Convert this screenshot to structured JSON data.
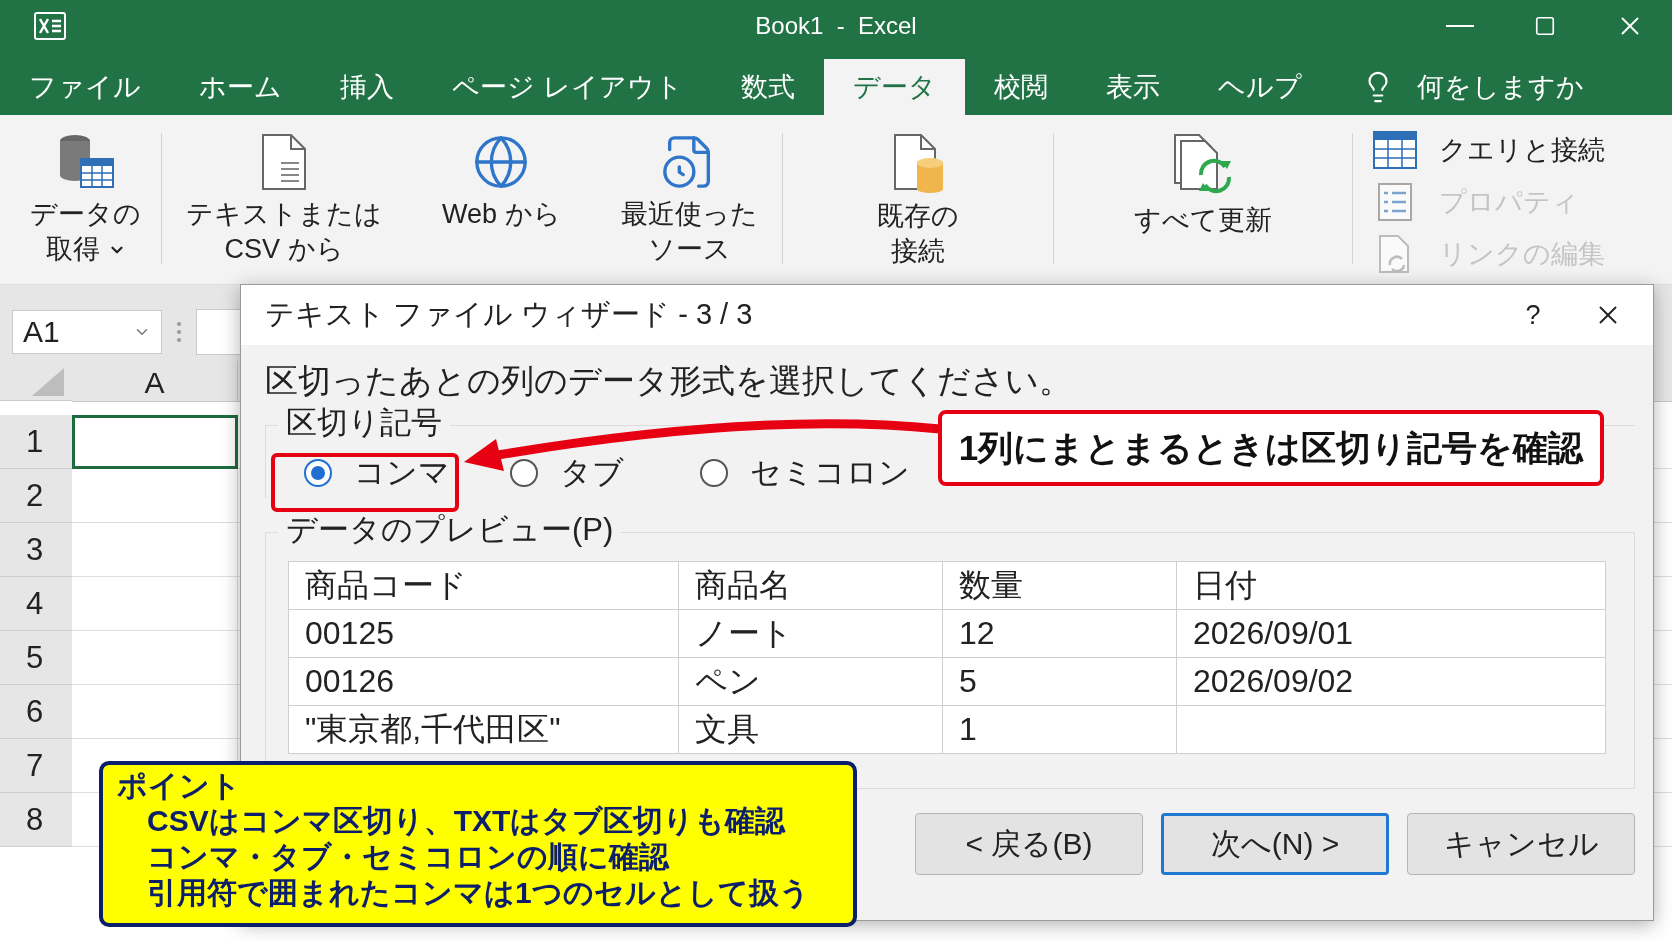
{
  "window": {
    "title": "Book1  -  Excel"
  },
  "tabs": [
    {
      "label": "ファイル",
      "selected": false
    },
    {
      "label": "ホーム",
      "selected": false
    },
    {
      "label": "挿入",
      "selected": false
    },
    {
      "label": "ページ レイアウト",
      "selected": false
    },
    {
      "label": "数式",
      "selected": false
    },
    {
      "label": "データ",
      "selected": true
    },
    {
      "label": "校閲",
      "selected": false
    },
    {
      "label": "表示",
      "selected": false
    },
    {
      "label": "ヘルプ",
      "selected": false
    }
  ],
  "tell_me": {
    "label": "何をしますか"
  },
  "ribbon": {
    "groups": [
      {
        "items": [
          {
            "kind": "large",
            "lines": [
              "データの",
              "取得"
            ],
            "dropdown": true
          }
        ]
      },
      {
        "items": [
          {
            "kind": "large",
            "lines": [
              "テキストまたは",
              "CSV から"
            ],
            "dropdown": false
          },
          {
            "kind": "large",
            "lines": [
              "Web から"
            ],
            "dropdown": false
          },
          {
            "kind": "large",
            "lines": [
              "最近使った",
              "ソース"
            ],
            "dropdown": false
          }
        ]
      },
      {
        "items": [
          {
            "kind": "large",
            "lines": [
              "既存の",
              "接続"
            ],
            "dropdown": false
          }
        ]
      },
      {
        "items": [
          {
            "kind": "large",
            "lines": [
              "すべて更新"
            ],
            "dropdown": false
          }
        ]
      },
      {
        "items": [
          {
            "kind": "small",
            "label": "クエリと接続",
            "disabled": false
          },
          {
            "kind": "small",
            "label": "プロパティ",
            "disabled": true
          },
          {
            "kind": "small",
            "label": "リンクの編集",
            "disabled": true
          }
        ]
      }
    ]
  },
  "name_box": {
    "value": "A1"
  },
  "grid": {
    "columns": [
      "A"
    ],
    "rows": [
      {
        "label": "1",
        "selected": true
      },
      {
        "label": "2",
        "selected": false
      },
      {
        "label": "3",
        "selected": false
      },
      {
        "label": "4",
        "selected": false
      },
      {
        "label": "5",
        "selected": false
      },
      {
        "label": "6",
        "selected": false
      },
      {
        "label": "7",
        "selected": false
      },
      {
        "label": "8",
        "selected": false
      }
    ]
  },
  "dialog": {
    "title": "テキスト ファイル ウィザード - 3 / 3",
    "help": "?",
    "instruction": "区切ったあとの列のデータ形式を選択してください。",
    "delimiters": {
      "legend": "区切り記号",
      "options": [
        {
          "label": "コンマ",
          "selected": true
        },
        {
          "label": "タブ",
          "selected": false
        },
        {
          "label": "セミコロン",
          "selected": false
        }
      ]
    },
    "preview": {
      "legend": "データのプレビュー(P)",
      "columns": [
        "商品コード",
        "商品名",
        "数量",
        "日付"
      ],
      "rows": [
        [
          "00125",
          "ノート",
          "12",
          "2026/09/01"
        ],
        [
          "00126",
          "ペン",
          "5",
          "2026/09/02"
        ],
        [
          "\"東京都,千代田区\"",
          "文具",
          "1"
        ]
      ]
    },
    "buttons": [
      {
        "label": "< 戻る(B)",
        "default": false
      },
      {
        "label": "次へ(N) >",
        "default": true
      },
      {
        "label": "キャンセル",
        "default": false
      }
    ]
  },
  "callouts": {
    "note": "1列にまとまるときは区切り記号を確認",
    "point": {
      "title": "ポイント",
      "lines": [
        "CSVはコンマ区切り、TXTはタブ区切りも確認",
        "コンマ・タブ・セミコロンの順に確認",
        "引用符で囲まれたコンマは1つのセルとして扱う"
      ]
    }
  }
}
